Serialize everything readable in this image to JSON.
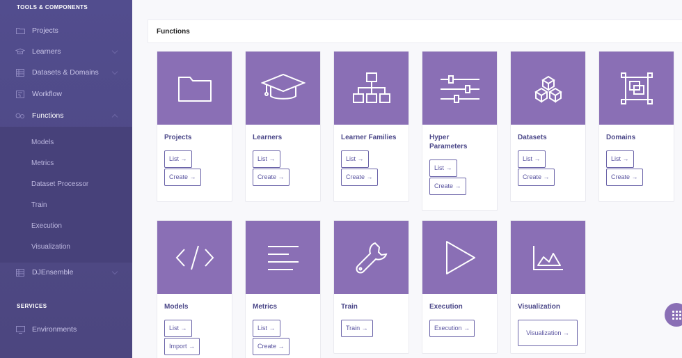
{
  "sidebar": {
    "section_tools": "TOOLS & COMPONENTS",
    "section_services": "SERVICES",
    "items": [
      {
        "label": "Projects",
        "icon": "folder-icon"
      },
      {
        "label": "Learners",
        "icon": "graduation-cap-icon"
      },
      {
        "label": "Datasets & Domains",
        "icon": "table-icon"
      },
      {
        "label": "Workflow",
        "icon": "workflow-icon"
      },
      {
        "label": "Functions",
        "icon": "functions-icon"
      }
    ],
    "sub_items": [
      "Models",
      "Metrics",
      "Dataset Processor",
      "Train",
      "Execution",
      "Visualization"
    ],
    "djensemble": "DJEnsemble",
    "environments": "Environments"
  },
  "panel": {
    "title": "Functions"
  },
  "cards": [
    {
      "title": "Projects",
      "icon": "folder-icon",
      "buttons": [
        "List →",
        "Create →"
      ]
    },
    {
      "title": "Learners",
      "icon": "graduation-cap-icon",
      "buttons": [
        "List →",
        "Create →"
      ]
    },
    {
      "title": "Learner Families",
      "icon": "hierarchy-icon",
      "buttons": [
        "List →",
        "Create →"
      ]
    },
    {
      "title": "Hyper Parameters",
      "icon": "sliders-icon",
      "buttons": [
        "List →",
        "Create →"
      ]
    },
    {
      "title": "Datasets",
      "icon": "cubes-icon",
      "buttons": [
        "List →",
        "Create →"
      ]
    },
    {
      "title": "Domains",
      "icon": "domain-icon",
      "buttons": [
        "List →",
        "Create →"
      ]
    },
    {
      "title": "Models",
      "icon": "code-icon",
      "buttons": [
        "List →",
        "Import →"
      ]
    },
    {
      "title": "Metrics",
      "icon": "lines-icon",
      "buttons": [
        "List →",
        "Create →"
      ]
    },
    {
      "title": "Train",
      "icon": "wrench-icon",
      "buttons": [
        "Train →"
      ]
    },
    {
      "title": "Execution",
      "icon": "play-icon",
      "buttons": [
        "Execution →"
      ]
    },
    {
      "title": "Visualization",
      "icon": "area-chart-icon",
      "buttons": [
        "Visualization →"
      ]
    }
  ],
  "colors": {
    "sidebar": "#524d8e",
    "accent": "#8a6fb5",
    "button_border": "#6a63a8"
  }
}
